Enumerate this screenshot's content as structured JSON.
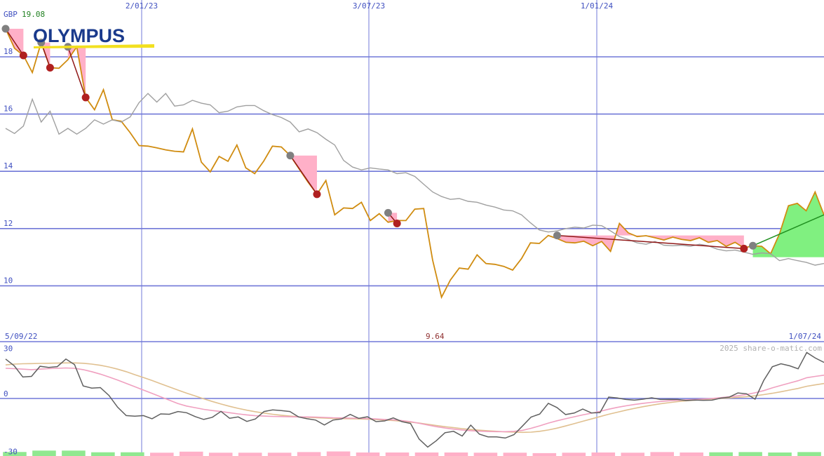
{
  "chart_data": [
    {
      "type": "line",
      "panel": "price",
      "currency_label": "GBP",
      "last_price": "19.08",
      "min_marker": "9.64",
      "start_date": "5/09/22",
      "end_date": "1/07/24",
      "watermark": "2025 share-o-matic.com",
      "logo_text": "OLYMPUS",
      "x_tick_labels": [
        "2/01/23",
        "3/07/23",
        "1/01/24"
      ],
      "y_ticks": [
        10,
        12,
        14,
        16,
        18
      ],
      "y_tick_labels": [
        "10",
        "12",
        "14",
        "16",
        "18"
      ],
      "ylim": [
        9,
        19.5
      ],
      "grid": true,
      "colors": {
        "price": "#d08c10",
        "comparison": "#a0a0a0",
        "grid": "#7078d8",
        "label_blue": "#4050c0",
        "label_green": "#208020",
        "label_red": "#903030",
        "peak_marker": "#808080",
        "trough_marker": "#b02020",
        "decline_fill": "#ffb0c8",
        "rise_fill": "#80f080",
        "decline_line": "#901818",
        "rise_line": "#209020"
      },
      "series": [
        {
          "role": "price",
          "values": [
            18.98,
            18.3,
            18.05,
            17.45,
            18.5,
            17.62,
            17.6,
            17.9,
            18.35,
            16.58,
            16.15,
            16.85,
            15.8,
            15.75,
            15.35,
            14.9,
            14.88,
            14.82,
            14.75,
            14.7,
            14.68,
            15.48,
            14.32,
            13.98,
            14.52,
            14.35,
            14.92,
            14.12,
            13.92,
            14.35,
            14.88,
            14.85,
            14.55,
            14.08,
            13.62,
            13.2,
            13.68,
            12.48,
            12.72,
            12.7,
            12.92,
            12.28,
            12.52,
            12.22,
            12.28,
            12.28,
            12.68,
            12.7,
            10.9,
            9.6,
            10.2,
            10.62,
            10.58,
            11.08,
            10.78,
            10.75,
            10.68,
            10.55,
            10.95,
            11.5,
            11.48,
            11.76,
            11.65,
            11.52,
            11.5,
            11.56,
            11.4,
            11.55,
            11.2,
            12.18,
            11.85,
            11.72,
            11.75,
            11.68,
            11.6,
            11.7,
            11.62,
            11.58,
            11.68,
            11.52,
            11.58,
            11.38,
            11.52,
            11.32,
            11.4,
            11.38,
            11.12,
            11.82,
            12.8,
            12.88,
            12.62,
            13.28,
            12.48
          ]
        },
        {
          "role": "comparison",
          "values": [
            15.5,
            15.32,
            15.58,
            16.52,
            15.72,
            16.1,
            15.3,
            15.5,
            15.3,
            15.5,
            15.8,
            15.65,
            15.8,
            15.72,
            15.9,
            16.4,
            16.72,
            16.42,
            16.72,
            16.28,
            16.32,
            16.48,
            16.38,
            16.32,
            16.05,
            16.1,
            16.25,
            16.3,
            16.3,
            16.12,
            15.98,
            15.88,
            15.72,
            15.38,
            15.48,
            15.35,
            15.12,
            14.92,
            14.38,
            14.15,
            14.05,
            14.12,
            14.08,
            14.05,
            13.92,
            13.95,
            13.82,
            13.55,
            13.28,
            13.12,
            13.02,
            13.05,
            12.95,
            12.92,
            12.82,
            12.75,
            12.65,
            12.62,
            12.48,
            12.2,
            11.95,
            11.88,
            11.92,
            12.0,
            12.05,
            12.02,
            12.12,
            12.1,
            11.92,
            11.72,
            11.62,
            11.5,
            11.45,
            11.55,
            11.42,
            11.4,
            11.42,
            11.38,
            11.45,
            11.4,
            11.28,
            11.22,
            11.25,
            11.18,
            11.1,
            11.15,
            11.12,
            10.88,
            10.95,
            10.88,
            10.82,
            10.72,
            10.78
          ]
        }
      ],
      "decline_events": [
        {
          "from_index": 0,
          "from_value": 18.98,
          "to_index": 2,
          "to_value": 18.05
        },
        {
          "from_index": 4,
          "from_value": 18.5,
          "to_index": 5,
          "to_value": 17.62
        },
        {
          "from_index": 7,
          "from_value": 18.35,
          "to_index": 9,
          "to_value": 16.58
        },
        {
          "from_index": 32,
          "from_value": 14.55,
          "to_index": 35,
          "to_value": 13.2
        },
        {
          "from_index": 43,
          "from_value": 12.55,
          "to_index": 44,
          "to_value": 12.18
        },
        {
          "from_index": 62,
          "from_value": 11.76,
          "to_index": 83,
          "to_value": 11.3
        }
      ],
      "rise_events": [
        {
          "from_index": 84,
          "from_value": 11.4,
          "to_index": 92,
          "to_value": 12.48
        }
      ]
    },
    {
      "type": "line",
      "panel": "oscillator",
      "y_ticks": [
        30,
        0,
        -30
      ],
      "y_tick_labels": [
        "30",
        "0",
        "-30"
      ],
      "ylim": [
        -32,
        32
      ],
      "colors": {
        "osc": "#606060",
        "fast_avg": "#f0a0c0",
        "slow_avg": "#e0c090",
        "zero_line": "#7078d8",
        "hist_pos": "#90e890",
        "hist_neg": "#ffb0c8"
      },
      "series": [
        {
          "role": "oscillator",
          "values": [
            23.5,
            19.5,
            12.8,
            13.2,
            19.2,
            18.5,
            19,
            23.5,
            20.2,
            7.5,
            6.2,
            6.5,
            1.8,
            -5.2,
            -10.2,
            -10.6,
            -10.2,
            -12.1,
            -9.2,
            -9.4,
            -7.8,
            -8.5,
            -10.8,
            -12.5,
            -11.2,
            -7.7,
            -11.8,
            -11,
            -13.7,
            -12.2,
            -7.8,
            -6.8,
            -7.2,
            -7.8,
            -11,
            -12.1,
            -12.9,
            -15.8,
            -12.9,
            -12.2,
            -9.5,
            -11.9,
            -10.9,
            -13.8,
            -13.4,
            -11.6,
            -13.8,
            -14.9,
            -24.2,
            -29,
            -25.2,
            -20.4,
            -19.6,
            -22.4,
            -15.9,
            -21.3,
            -22.9,
            -22.9,
            -23.6,
            -21.6,
            -16.4,
            -11.1,
            -9.3,
            -2.9,
            -5.4,
            -9.6,
            -8.7,
            -6.3,
            -8.6,
            -8.4,
            0.8,
            0.3,
            -0.6,
            -1.0,
            -0.4,
            0.4,
            -0.6,
            -0.5,
            -0.6,
            -1.2,
            -0.9,
            -1.1,
            -1.0,
            0.2,
            0.8,
            3.3,
            2.8,
            -0.4,
            10.7,
            18.9,
            20.7,
            19.5,
            17.7,
            27.4,
            24.1,
            21.5
          ]
        },
        {
          "role": "fast_average",
          "values": [
            18,
            17.8,
            17.5,
            17.2,
            17.5,
            17.8,
            18,
            18.2,
            18,
            17.2,
            16,
            14.5,
            12.8,
            11,
            9,
            7,
            5,
            3,
            1,
            -1,
            -3,
            -4.5,
            -5.5,
            -6.5,
            -7.2,
            -7.8,
            -8.5,
            -9.2,
            -9.8,
            -10.3,
            -10.5,
            -10.7,
            -10.8,
            -10.9,
            -11,
            -11,
            -11.1,
            -11.3,
            -11.5,
            -11.6,
            -11.7,
            -11.8,
            -12,
            -12.2,
            -12.5,
            -12.7,
            -13.2,
            -13.8,
            -14.8,
            -15.8,
            -16.8,
            -17.6,
            -18.3,
            -18.8,
            -19.2,
            -19.5,
            -19.7,
            -19.8,
            -19.8,
            -19.6,
            -19,
            -17.8,
            -16.3,
            -14.7,
            -13.3,
            -12.1,
            -10.9,
            -9.8,
            -8.8,
            -7.7,
            -6.4,
            -5.3,
            -4.4,
            -3.6,
            -2.9,
            -2.3,
            -1.8,
            -1.4,
            -1.1,
            -0.8,
            -0.6,
            -0.3,
            0,
            0.5,
            1,
            1.6,
            2.4,
            3.4,
            4.7,
            6.3,
            7.8,
            9.2,
            10.6,
            12.4,
            13.2,
            13.9
          ]
        },
        {
          "role": "slow_average",
          "values": [
            20,
            20.5,
            20.7,
            20.8,
            20.9,
            21,
            21.1,
            21.2,
            21.2,
            21,
            20.5,
            19.8,
            18.8,
            17.5,
            16,
            14.2,
            12.5,
            10.7,
            8.8,
            6.9,
            5,
            3.2,
            1.5,
            -0.2,
            -1.8,
            -3.3,
            -4.7,
            -5.9,
            -7,
            -7.9,
            -8.7,
            -9.4,
            -10,
            -10.5,
            -10.9,
            -11.2,
            -11.5,
            -11.7,
            -11.9,
            -12,
            -12.1,
            -12.2,
            -12.4,
            -12.6,
            -12.9,
            -13.2,
            -13.6,
            -14.1,
            -14.7,
            -15.4,
            -16.1,
            -16.8,
            -17.4,
            -18,
            -18.5,
            -18.9,
            -19.3,
            -19.6,
            -19.9,
            -20.1,
            -20.2,
            -20.1,
            -19.6,
            -18.8,
            -17.7,
            -16.4,
            -15,
            -13.6,
            -12.2,
            -10.8,
            -9.4,
            -8.2,
            -7,
            -5.9,
            -4.9,
            -4,
            -3.2,
            -2.5,
            -1.9,
            -1.4,
            -1,
            -0.6,
            -0.3,
            0,
            0.3,
            0.7,
            1.1,
            1.6,
            2.3,
            3.1,
            4,
            5,
            6,
            7.3,
            8.1,
            8.9
          ]
        }
      ],
      "histogram": [
        {
          "sign": "positive",
          "level": 0.62
        },
        {
          "sign": "positive",
          "level": 0.95
        },
        {
          "sign": "positive",
          "level": 0.95
        },
        {
          "sign": "positive",
          "level": 0.55
        },
        {
          "sign": "positive",
          "level": 0.55
        },
        {
          "sign": "negative",
          "level": 0.45
        },
        {
          "sign": "negative",
          "level": 0.7
        },
        {
          "sign": "negative",
          "level": 0.45
        },
        {
          "sign": "negative",
          "level": 0.45
        },
        {
          "sign": "negative",
          "level": 0.45
        },
        {
          "sign": "negative",
          "level": 0.6
        },
        {
          "sign": "negative",
          "level": 0.75
        },
        {
          "sign": "negative",
          "level": 0.5
        },
        {
          "sign": "negative",
          "level": 0.5
        },
        {
          "sign": "negative",
          "level": 0.5
        },
        {
          "sign": "negative",
          "level": 0.5
        },
        {
          "sign": "negative",
          "level": 0.45
        },
        {
          "sign": "negative",
          "level": 0.45
        },
        {
          "sign": "negative",
          "level": 0.35
        },
        {
          "sign": "negative",
          "level": 0.45
        },
        {
          "sign": "negative",
          "level": 0.5
        },
        {
          "sign": "negative",
          "level": 0.45
        },
        {
          "sign": "negative",
          "level": 0.6
        },
        {
          "sign": "negative",
          "level": 0.5
        },
        {
          "sign": "positive",
          "level": 0.55
        },
        {
          "sign": "positive",
          "level": 0.6
        },
        {
          "sign": "positive",
          "level": 0.5
        },
        {
          "sign": "positive",
          "level": 0.6
        }
      ]
    }
  ]
}
